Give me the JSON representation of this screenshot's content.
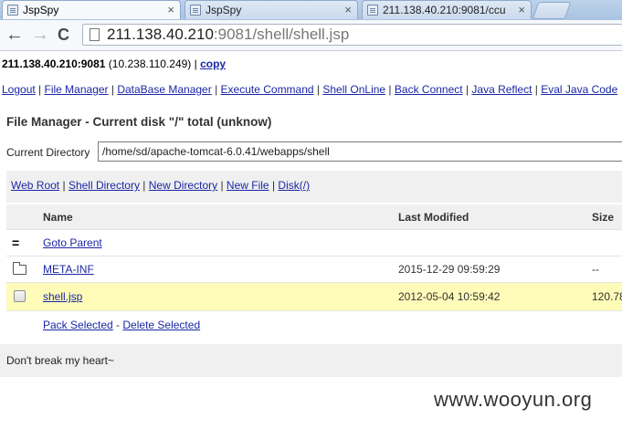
{
  "browser": {
    "tabs": [
      {
        "label": "JspSpy",
        "close": "×"
      },
      {
        "label": "JspSpy",
        "close": "×"
      },
      {
        "label": "211.138.40.210:9081/ccu",
        "close": "×"
      }
    ],
    "nav": {
      "back": "←",
      "forward": "→",
      "reload": "C"
    },
    "address": {
      "host": "211.138.40.210",
      "rest": ":9081/shell/shell.jsp"
    }
  },
  "header": {
    "host_bold": "211.138.40.210:9081",
    "host_rest": " (10.238.110.249) | ",
    "copy_link": "copy"
  },
  "menu": {
    "items": [
      "Logout",
      "File Manager",
      "DataBase Manager",
      "Execute Command",
      "Shell OnLine",
      "Back Connect",
      "Java Reflect",
      "Eval Java Code"
    ],
    "separator": " | "
  },
  "file_manager": {
    "title": "File Manager - Current disk \"/\" total (unknow)",
    "current_dir_label": "Current Directory",
    "current_dir_value": "/home/sd/apache-tomcat-6.0.41/webapps/shell",
    "quick_links": [
      "Web Root",
      "Shell Directory",
      "New Directory",
      "New File",
      "Disk(/)"
    ],
    "columns": {
      "name": "Name",
      "modified": "Last Modified",
      "size": "Size"
    },
    "rows": [
      {
        "icon": "=",
        "name": "Goto Parent",
        "modified": "",
        "size": ""
      },
      {
        "icon": "folder",
        "name": "META-INF",
        "modified": "2015-12-29 09:59:29",
        "size": "--"
      },
      {
        "icon": "checkbox",
        "name": "shell.jsp",
        "modified": "2012-05-04 10:59:42",
        "size": "120.78"
      }
    ],
    "actions": {
      "pack": "Pack Selected",
      "sep": " - ",
      "delete": "Delete Selected"
    }
  },
  "footer": {
    "text": "Don't break my heart~"
  },
  "watermark": "www.wooyun.org"
}
